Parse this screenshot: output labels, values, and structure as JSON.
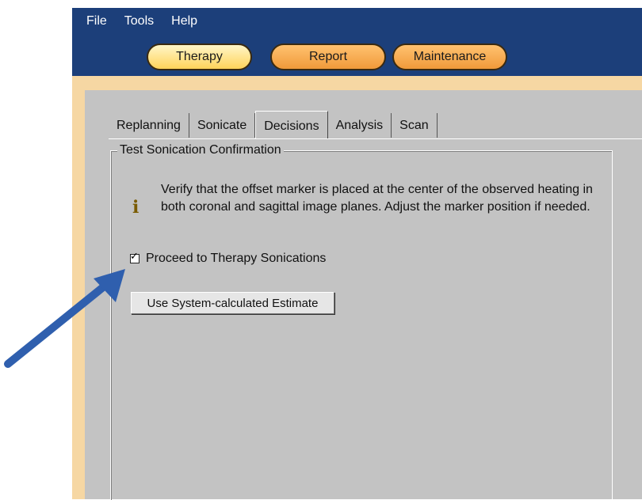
{
  "menu": [
    "File",
    "Tools",
    "Help"
  ],
  "main_tabs": [
    "Therapy",
    "Report",
    "Maintenance"
  ],
  "sub_tabs": [
    "Replanning",
    "Sonicate",
    "Decisions",
    "Analysis",
    "Scan"
  ],
  "group": {
    "title": "Test Sonication Confirmation",
    "info": "Verify that the offset marker is placed at the center of the observed heating in both coronal and sagittal image planes. Adjust the marker position if needed.",
    "checkbox_label": "Proceed to Therapy Sonications",
    "button_label": "Use System-calculated Estimate"
  },
  "checkbox_checked": true,
  "colors": {
    "titlebar": "#1c3f7a",
    "frame": "#f6d7a3",
    "panel": "#c3c3c3",
    "arrow": "#2f5fae"
  }
}
